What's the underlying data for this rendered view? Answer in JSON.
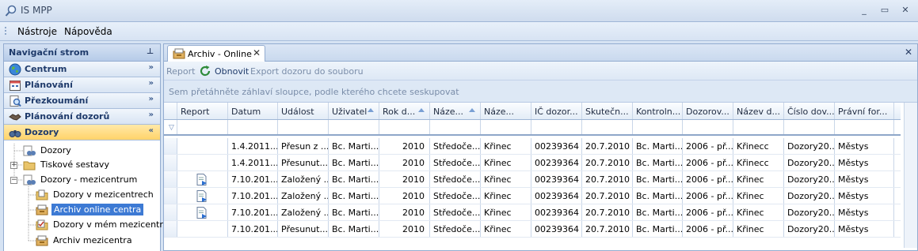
{
  "window": {
    "title": "IS MPP",
    "minimize": "_",
    "maximize": "▭",
    "close": "✕"
  },
  "menubar": {
    "items": [
      "Nástroje",
      "Nápověda"
    ]
  },
  "nav": {
    "header": "Navigační strom",
    "pin": "⊥",
    "sections": [
      {
        "label": "Centrum",
        "icon": "globe-icon",
        "chev": "»"
      },
      {
        "label": "Plánování",
        "icon": "calendar-icon",
        "chev": "»"
      },
      {
        "label": "Přezkoumání",
        "icon": "magnifier-icon",
        "chev": "»"
      },
      {
        "label": "Plánování dozorů",
        "icon": "handshake-icon",
        "chev": "»"
      },
      {
        "label": "Dozory",
        "icon": "binoculars-icon",
        "chev": "«"
      }
    ],
    "tree": [
      {
        "label": "Dozory",
        "icon": "binoculars-icon"
      },
      {
        "label": "Tiskové sestavy",
        "icon": "folder-icon",
        "expander": "+"
      },
      {
        "label": "Dozory - mezicentrum",
        "icon": "binoculars-icon",
        "expander": "−"
      },
      {
        "label": "Dozory v mezicentrech",
        "icon": "document-folder-icon"
      },
      {
        "label": "Archiv online centra",
        "icon": "archive-icon",
        "selected": true
      },
      {
        "label": "Dozory v mém mezicentru",
        "icon": "checklist-icon"
      },
      {
        "label": "Archiv mezicentra",
        "icon": "archive-icon"
      }
    ]
  },
  "tab": {
    "label": "Archiv - Online",
    "close": "✕",
    "close_all": "✕"
  },
  "toolbar": {
    "report": "Report",
    "refresh": "Obnovit",
    "export": "Export dozoru do souboru"
  },
  "group_hint": "Sem přetáhněte záhlaví sloupce, podle kterého chcete seskupovat",
  "grid": {
    "columns": [
      "Report",
      "Datum",
      "Událost",
      "Uživatel",
      "Rok d...",
      "Náze...",
      "Náze...",
      "IČ dozor...",
      "Skutečn...",
      "Kontroln...",
      "Dozorov...",
      "Název d...",
      "Číslo dov...",
      "Právní for..."
    ],
    "rows": [
      {
        "report": false,
        "cells": [
          "1.4.2011...",
          "Přesun z ...",
          "Bc. Marti...",
          "2010",
          "Středoče...",
          "Křinec",
          "00239364",
          "20.7.2010",
          "Bc. Marti...",
          "2006 - př...",
          "Křinecc",
          "Dozory20...",
          "Městys"
        ]
      },
      {
        "report": false,
        "cells": [
          "1.4.2011...",
          "Přesunut...",
          "Bc. Marti...",
          "2010",
          "Středoče...",
          "Křinec",
          "00239364",
          "20.7.2010",
          "Bc. Marti...",
          "2006 - př...",
          "Křinecc",
          "Dozory20...",
          "Městys"
        ]
      },
      {
        "report": true,
        "cells": [
          "7.10.201...",
          "Založený ...",
          "Bc. Marti...",
          "2010",
          "Středoče...",
          "Křinec",
          "00239364",
          "20.7.2010",
          "Bc. Marti...",
          "2006 - př...",
          "Křinec",
          "Dozory20...",
          "Městys"
        ]
      },
      {
        "report": true,
        "cells": [
          "7.10.201...",
          "Založený ...",
          "Bc. Marti...",
          "2010",
          "Středoče...",
          "Křinec",
          "00239364",
          "20.7.2010",
          "Bc. Marti...",
          "2006 - př...",
          "Křinec",
          "Dozory20...",
          "Městys"
        ]
      },
      {
        "report": true,
        "cells": [
          "7.10.201...",
          "Založený ...",
          "Bc. Marti...",
          "2010",
          "Středoče...",
          "Křinec",
          "00239364",
          "20.7.2010",
          "Bc. Marti...",
          "2006 - př...",
          "Křinec",
          "Dozory20...",
          "Městys"
        ]
      },
      {
        "report": false,
        "cells": [
          "7.10.201...",
          "Přesunut...",
          "Bc. Marti...",
          "2010",
          "Středoče...",
          "Křinec",
          "00239364",
          "20.7.2010",
          "Bc. Marti...",
          "2006 - př...",
          "Křinec",
          "Dozory20...",
          "Městys"
        ]
      }
    ]
  }
}
